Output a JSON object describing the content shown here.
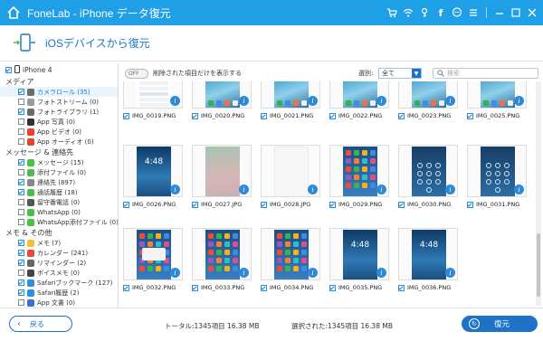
{
  "window": {
    "title": "FoneLab - iPhone データ復元"
  },
  "header": {
    "title": "iOSデバイスから復元"
  },
  "sidebar": {
    "device": "iPhone 4",
    "sections": [
      {
        "title": "メディア",
        "items": [
          {
            "label": "カメラロール (35)",
            "checked": true,
            "selected": true,
            "icon_color": "#6b6b6b"
          },
          {
            "label": "フォトストリーム (0)",
            "checked": false,
            "icon_color": "#9a9a9a"
          },
          {
            "label": "フォトライブラリ (1)",
            "checked": true,
            "icon_color": "#6b6b6b"
          },
          {
            "label": "App 写真 (0)",
            "checked": false,
            "icon_color": "#333333"
          },
          {
            "label": "App ビデオ (0)",
            "checked": false,
            "icon_color": "#e6442a"
          },
          {
            "label": "App オーディオ (0)",
            "checked": false,
            "icon_color": "#e6442a"
          }
        ]
      },
      {
        "title": "メッセージ & 連絡先",
        "items": [
          {
            "label": "メッセージ (15)",
            "checked": true,
            "icon_color": "#48c04a"
          },
          {
            "label": "添付ファイル (0)",
            "checked": false,
            "icon_color": "#48c04a"
          },
          {
            "label": "連絡先 (897)",
            "checked": true,
            "icon_color": "#888888"
          },
          {
            "label": "通話履歴 (18)",
            "checked": true,
            "icon_color": "#48c04a"
          },
          {
            "label": "留守番電話 (0)",
            "checked": false,
            "icon_color": "#555555"
          },
          {
            "label": "WhatsApp (0)",
            "checked": false,
            "icon_color": "#48c04a"
          },
          {
            "label": "WhatsApp添付ファイル (0)",
            "checked": false,
            "icon_color": "#48c04a"
          }
        ]
      },
      {
        "title": "メモ & その他",
        "items": [
          {
            "label": "メモ (7)",
            "checked": true,
            "icon_color": "#f2c230"
          },
          {
            "label": "カレンダー (241)",
            "checked": true,
            "icon_color": "#e84a3a"
          },
          {
            "label": "リマインダー (2)",
            "checked": true,
            "icon_color": "#666666"
          },
          {
            "label": "ボイスメモ (0)",
            "checked": false,
            "icon_color": "#444444"
          },
          {
            "label": "Safariブックマーク (127)",
            "checked": true,
            "icon_color": "#2e8ee6"
          },
          {
            "label": "Safari履歴 (2)",
            "checked": true,
            "icon_color": "#2e8ee6"
          },
          {
            "label": "App 文書 (0)",
            "checked": false,
            "icon_color": "#3a6fcf"
          }
        ]
      }
    ]
  },
  "toolbar": {
    "toggle_label": "OFF",
    "toggle_text": "削除された項目だけを表示する",
    "filter_label": "選別:",
    "filter_value": "全て",
    "search_placeholder": "検索"
  },
  "files": [
    {
      "name": "IMG_0019.PNG",
      "style": "settings",
      "checked": true
    },
    {
      "name": "IMG_0020.PNG",
      "style": "wave",
      "checked": true
    },
    {
      "name": "IMG_0021.PNG",
      "style": "wave",
      "checked": true
    },
    {
      "name": "IMG_0022.PNG",
      "style": "wave",
      "checked": true
    },
    {
      "name": "IMG_0023.PNG",
      "style": "wave",
      "checked": true
    },
    {
      "name": "IMG_0025.PNG",
      "style": "wave",
      "checked": true
    },
    {
      "name": "IMG_0026.PNG",
      "style": "lock",
      "checked": true
    },
    {
      "name": "IMG_0027.JPG",
      "style": "blur",
      "checked": true
    },
    {
      "name": "IMG_0028.JPG",
      "style": "white",
      "checked": true
    },
    {
      "name": "IMG_0029.PNG",
      "style": "home",
      "checked": true
    },
    {
      "name": "IMG_0030.PNG",
      "style": "keypad",
      "checked": true
    },
    {
      "name": "IMG_0031.PNG",
      "style": "keypad",
      "checked": true
    },
    {
      "name": "IMG_0032.PNG",
      "style": "alert",
      "checked": true
    },
    {
      "name": "IMG_0033.PNG",
      "style": "home",
      "checked": true
    },
    {
      "name": "IMG_0034.PNG",
      "style": "home",
      "checked": true
    },
    {
      "name": "IMG_0035.PNG",
      "style": "lock",
      "checked": true
    },
    {
      "name": "IMG_0036.PNG",
      "style": "lock",
      "checked": true
    }
  ],
  "lockscreen_time": "4:48",
  "footer": {
    "back_label": "戻る",
    "total": "トータル:1345項目 16.38 MB",
    "selected": "選択された:1345項目 16.38 MB",
    "recover_label": "復元"
  },
  "colors": {
    "accent": "#1e9fe6",
    "button": "#1e72c8"
  }
}
